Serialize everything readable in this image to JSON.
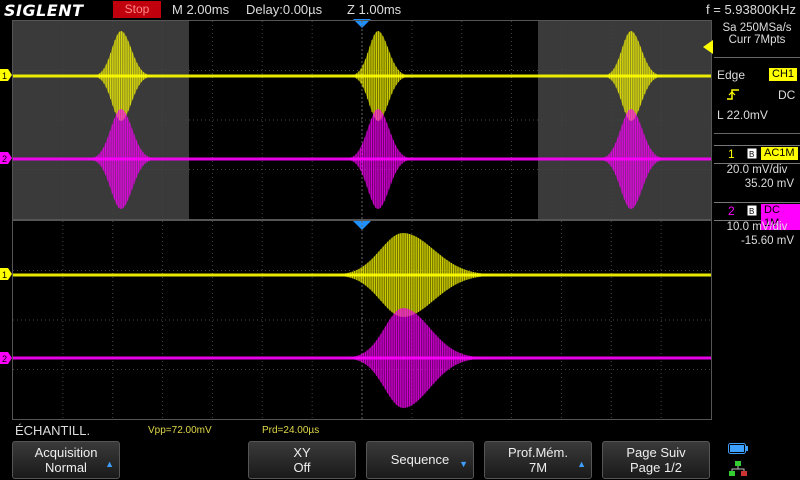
{
  "topbar": {
    "brand": "SIGLENT",
    "run_state": "Stop",
    "timebase": "M 2.00ms",
    "delay": "Delay:0.00µs",
    "zoom": "Z 1.00ms",
    "frequency": "f = 5.93800KHz"
  },
  "right_panel": {
    "sample_rate": "Sa 250MSa/s",
    "memory": "Curr 7Mpts",
    "trigger": {
      "type": "Edge",
      "source": "CH1",
      "slope_icon": "rising-edge-icon",
      "coupling": "DC",
      "level": "L  22.0mV"
    },
    "ch1": {
      "number": "1",
      "coupling": "AC1M",
      "scale": "20.0 mV/div",
      "offset": "35.20 mV",
      "color": "#ffff00"
    },
    "ch2": {
      "number": "2",
      "coupling": "DC 1M",
      "scale": "10.0 mV/div",
      "offset": "-15.60 mV",
      "color": "#ff00ff"
    }
  },
  "measurements": {
    "mode": "ÉCHANTILL.",
    "vpp": "Vpp=72.00mV",
    "prd": "Prd=24.00µs"
  },
  "softkeys": [
    {
      "line1": "Acquisition",
      "line2": "Normal",
      "arrow": true
    },
    {
      "line1": "XY",
      "line2": "Off",
      "arrow": false
    },
    {
      "line1": "Sequence",
      "line2": "",
      "arrow": true
    },
    {
      "line1": "Prof.Mém.",
      "line2": "7M",
      "arrow": true
    },
    {
      "line1": "Page Suiv",
      "line2": "Page 1/2",
      "arrow": false
    }
  ],
  "colors": {
    "ch1": "#ffff00",
    "ch2": "#ff00ff",
    "trigger_marker": "#1e90ff",
    "stop_badge": "#c0000c"
  }
}
